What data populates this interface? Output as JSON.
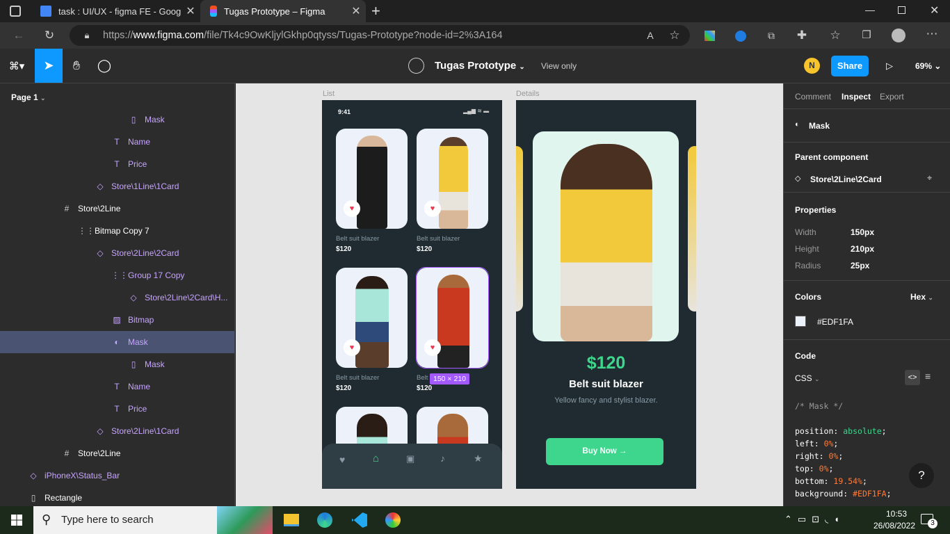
{
  "browser": {
    "tabs": [
      {
        "title": "task : UI/UX - figma FE - Google",
        "active": false
      },
      {
        "title": "Tugas Prototype – Figma",
        "active": true
      }
    ],
    "url_prefix": "https://",
    "url_host": "www.figma.com",
    "url_path": "/file/Tk4c9OwKljylGkhp0qtyss/Tugas-Prototype?node-id=2%3A164"
  },
  "toolbar": {
    "file_name": "Tugas Prototype",
    "mode": "View only",
    "avatar_initial": "N",
    "share_label": "Share",
    "zoom": "69%"
  },
  "layers_panel": {
    "page": "Page 1",
    "items": [
      {
        "label": "Mask",
        "icon": "rect-icon",
        "purple": true
      },
      {
        "label": "Name",
        "icon": "text-icon",
        "purple": true
      },
      {
        "label": "Price",
        "icon": "text-icon",
        "purple": true
      },
      {
        "label": "Store\\1Line\\1Card",
        "icon": "instance-icon",
        "purple": true
      },
      {
        "label": "Store\\2Line",
        "icon": "frame-icon",
        "purple": false
      },
      {
        "label": "Bitmap Copy 7",
        "icon": "group-icon",
        "purple": false
      },
      {
        "label": "Store\\2Line\\2Card",
        "icon": "instance-icon",
        "purple": true
      },
      {
        "label": "Group 17 Copy",
        "icon": "group-icon",
        "purple": true
      },
      {
        "label": "Store\\2Line\\2Card\\H...",
        "icon": "instance-icon",
        "purple": true
      },
      {
        "label": "Bitmap",
        "icon": "image-icon",
        "purple": true
      },
      {
        "label": "Mask",
        "icon": "mask-icon",
        "purple": true,
        "selected": true
      },
      {
        "label": "Mask",
        "icon": "rect-icon",
        "purple": true
      },
      {
        "label": "Name",
        "icon": "text-icon",
        "purple": true
      },
      {
        "label": "Price",
        "icon": "text-icon",
        "purple": true
      },
      {
        "label": "Store\\2Line\\1Card",
        "icon": "instance-icon",
        "purple": true
      },
      {
        "label": "Store\\2Line",
        "icon": "frame-icon",
        "purple": false
      },
      {
        "label": "iPhoneX\\Status_Bar",
        "icon": "instance-icon",
        "purple": true
      },
      {
        "label": "Rectangle",
        "icon": "rect-icon",
        "purple": false
      }
    ]
  },
  "canvas": {
    "frame_list_label": "List",
    "frame_details_label": "Details",
    "status_time": "9:41",
    "cards": [
      {
        "name": "Belt suit blazer",
        "price": "$120"
      },
      {
        "name": "Belt suit blazer",
        "price": "$120"
      },
      {
        "name": "Belt suit blazer",
        "price": "$120"
      },
      {
        "name": "Belt",
        "price": "$120"
      }
    ],
    "selection_size": "150 × 210",
    "details": {
      "price": "$120",
      "title": "Belt suit blazer",
      "subtitle": "Yellow fancy and stylist blazer.",
      "button": "Buy Now →"
    }
  },
  "inspect": {
    "tabs": [
      "Comment",
      "Inspect",
      "Export"
    ],
    "layer_name": "Mask",
    "parent_heading": "Parent component",
    "parent_name": "Store\\2Line\\2Card",
    "props_heading": "Properties",
    "props": [
      {
        "key": "Width",
        "value": "150px"
      },
      {
        "key": "Height",
        "value": "210px"
      },
      {
        "key": "Radius",
        "value": "25px"
      }
    ],
    "colors_heading": "Colors",
    "color_format": "Hex",
    "color_value": "#EDF1FA",
    "code_heading": "Code",
    "code_lang": "CSS",
    "code_comment": "/* Mask */",
    "code_lines": [
      {
        "prop": "position",
        "val": "absolute",
        "kind": "v"
      },
      {
        "prop": "left",
        "val": "0%",
        "kind": "n"
      },
      {
        "prop": "right",
        "val": "0%",
        "kind": "n"
      },
      {
        "prop": "top",
        "val": "0%",
        "kind": "n"
      },
      {
        "prop": "bottom",
        "val": "19.54%",
        "kind": "n"
      },
      {
        "prop": "background",
        "val": "#EDF1FA",
        "kind": "n"
      }
    ],
    "help": "?"
  },
  "taskbar": {
    "search_placeholder": "Type here to search",
    "time": "10:53",
    "date": "26/08/2022",
    "notif_count": "3"
  },
  "colors": {
    "accent_blue": "#0d99ff",
    "selection_purple": "#a259ff",
    "frame_dark": "#1f2b31",
    "green": "#3dd68c",
    "card_bg": "#edf1fa"
  }
}
